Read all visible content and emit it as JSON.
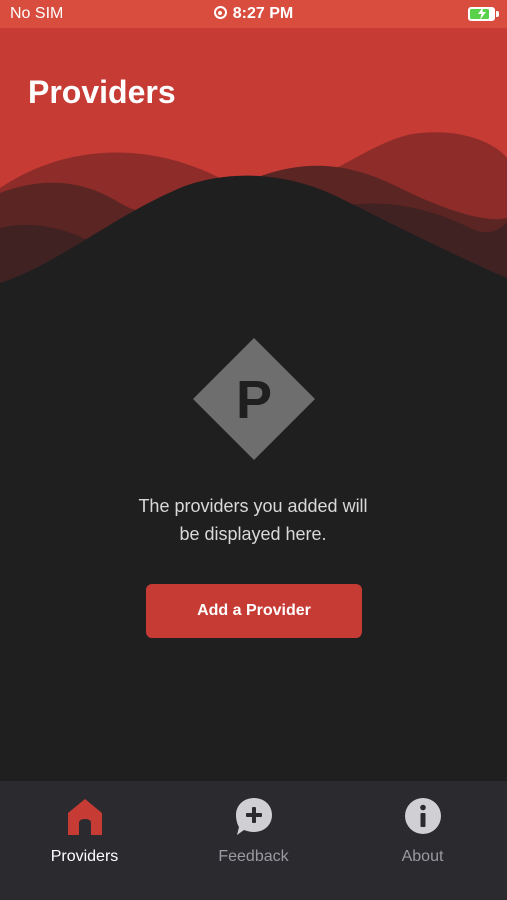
{
  "status_bar": {
    "carrier": "No SIM",
    "time": "8:27 PM",
    "battery_level": 0.85,
    "charging": true
  },
  "header": {
    "title": "Providers"
  },
  "empty_state": {
    "logo_letter": "P",
    "message": "The providers you added will\nbe displayed here.",
    "button_label": "Add a Provider"
  },
  "tab_bar": {
    "tabs": [
      {
        "label": "Providers",
        "icon": "home-icon",
        "active": true
      },
      {
        "label": "Feedback",
        "icon": "feedback-plus-icon",
        "active": false
      },
      {
        "label": "About",
        "icon": "info-icon",
        "active": false
      }
    ]
  },
  "colors": {
    "accent": "#c73b35",
    "status_bar": "#d94d3f",
    "background": "#1f1f20",
    "tab_bar": "#2b2a2f",
    "inactive_tab": "#9a9aa0",
    "logo_gray": "#6e6e6e"
  }
}
